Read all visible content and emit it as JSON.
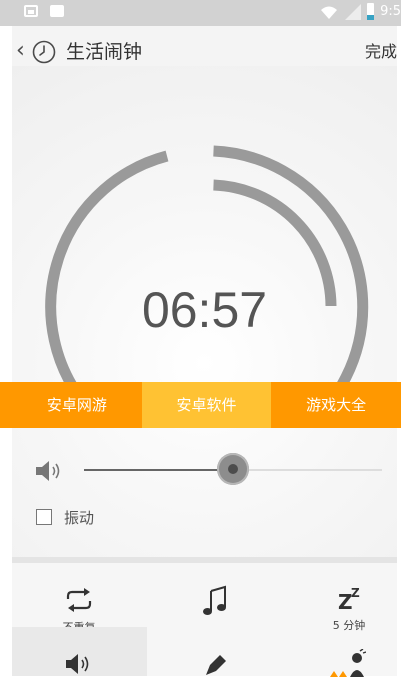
{
  "status_bar": {
    "time": "9:5"
  },
  "header": {
    "title": "生活闹钟",
    "done_label": "完成"
  },
  "alarm": {
    "time": "06:57"
  },
  "banner": {
    "cut_label": "",
    "tabs": [
      "安卓网游",
      "安卓软件",
      "游戏大全"
    ],
    "active_index": 1
  },
  "volume": {
    "level": 0.5
  },
  "vibrate": {
    "label": "振动",
    "checked": false
  },
  "options": [
    {
      "icon": "repeat-icon",
      "label": "不重复"
    },
    {
      "icon": "music-note-icon",
      "label": ""
    },
    {
      "icon": "snooze-icon",
      "label": "5 分钟"
    }
  ],
  "bottom_icons": [
    "speaker-icon",
    "pencil-icon",
    "person-icon"
  ],
  "colors": {
    "banner": "#ff9800",
    "banner_active": "#ffc233",
    "ring": "#9a9a9a"
  }
}
